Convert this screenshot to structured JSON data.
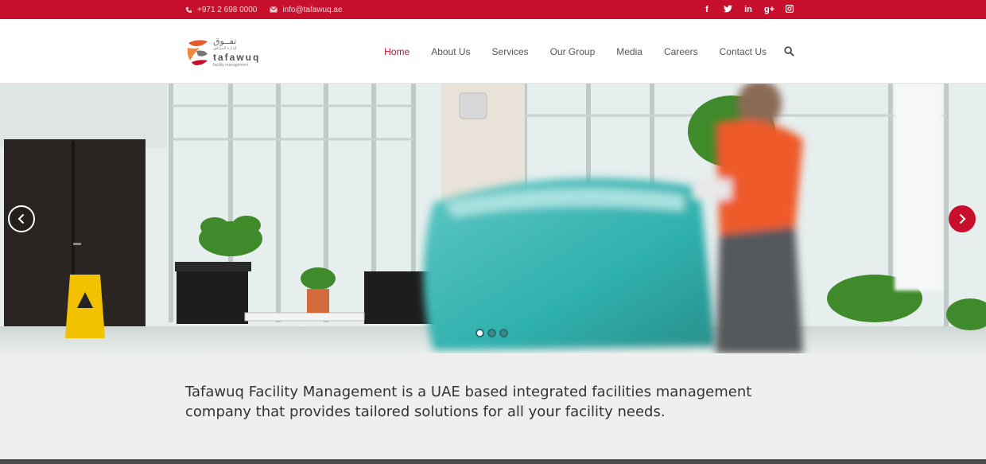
{
  "topbar": {
    "phone": "+971 2 698 0000",
    "email": "info@tafawuq.ae",
    "social": [
      {
        "icon": "facebook-icon",
        "glyph": "f"
      },
      {
        "icon": "twitter-icon",
        "glyph": "t"
      },
      {
        "icon": "linkedin-icon",
        "glyph": "in"
      },
      {
        "icon": "google-plus-icon",
        "glyph": "g+"
      },
      {
        "icon": "instagram-icon",
        "glyph": "◙"
      }
    ]
  },
  "logo": {
    "arabic": "تفــوق",
    "arabic_sub": "لإدارة المرافق",
    "name": "tafawuq",
    "tagline": "facility management"
  },
  "nav": {
    "items": [
      {
        "label": "Home",
        "active": true
      },
      {
        "label": "About Us",
        "active": false
      },
      {
        "label": "Services",
        "active": false
      },
      {
        "label": "Our Group",
        "active": false
      },
      {
        "label": "Media",
        "active": false
      },
      {
        "label": "Careers",
        "active": false
      },
      {
        "label": "Contact Us",
        "active": false
      }
    ]
  },
  "slider": {
    "slide_count": 3,
    "active_index": 0
  },
  "intro": {
    "text": "Tafawuq Facility Management is a UAE based integrated facilities management company that provides tailored solutions for all your facility needs."
  },
  "colors": {
    "brand_red": "#c8102e",
    "text": "#333333"
  }
}
